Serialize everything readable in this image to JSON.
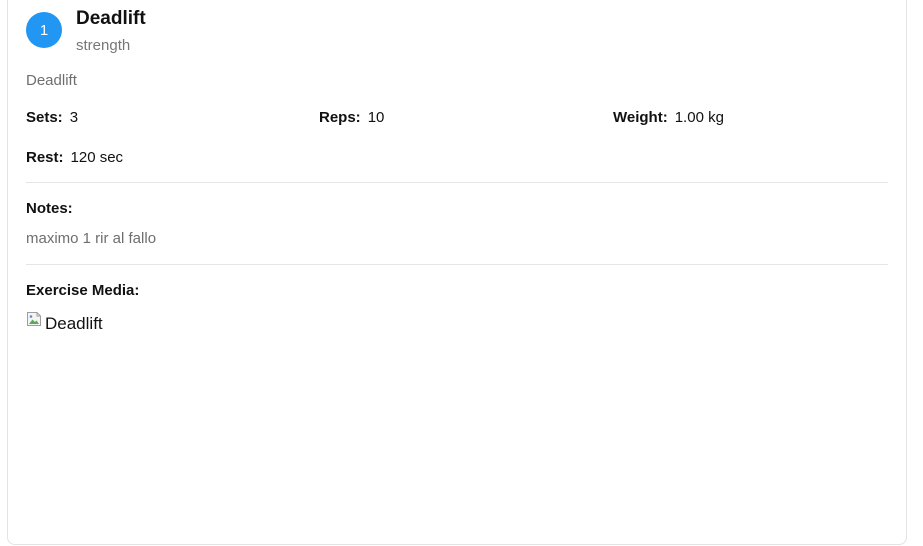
{
  "exercise": {
    "index": "1",
    "name": "Deadlift",
    "category": "strength",
    "description": "Deadlift"
  },
  "stats": {
    "sets_label": "Sets:",
    "sets_value": "3",
    "reps_label": "Reps:",
    "reps_value": "10",
    "weight_label": "Weight:",
    "weight_value": "1.00 kg",
    "rest_label": "Rest:",
    "rest_value": "120 sec"
  },
  "notes": {
    "label": "Notes:",
    "text": "maximo 1 rir al fallo"
  },
  "media": {
    "label": "Exercise Media:",
    "image_alt": "Deadlift",
    "icon": "broken-image-icon"
  },
  "colors": {
    "accent": "#2196f3",
    "muted_text": "#6e6e6e",
    "divider": "#e6e6e6"
  }
}
